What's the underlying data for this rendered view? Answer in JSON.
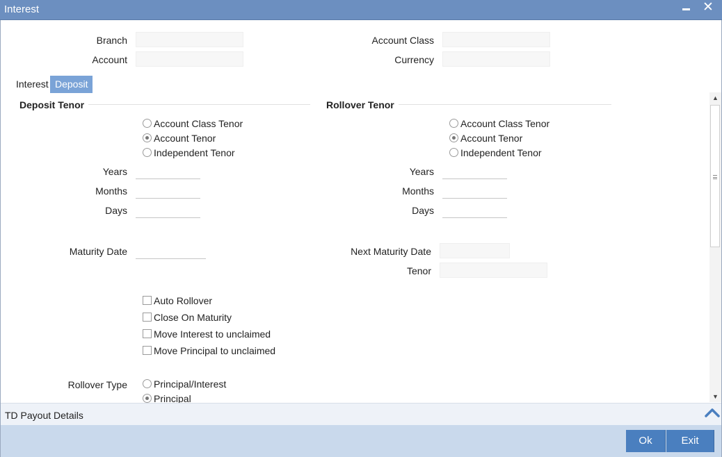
{
  "window": {
    "title": "Interest",
    "close_glyph": "✕"
  },
  "header": {
    "branch_label": "Branch",
    "account_label": "Account",
    "account_class_label": "Account Class",
    "currency_label": "Currency"
  },
  "tabs": [
    {
      "label": "Interest",
      "active": false
    },
    {
      "label": "Deposit",
      "active": true
    }
  ],
  "deposit_tenor": {
    "title": "Deposit Tenor",
    "options": [
      {
        "label": "Account Class Tenor",
        "checked": false
      },
      {
        "label": "Account Tenor",
        "checked": true
      },
      {
        "label": "Independent Tenor",
        "checked": false
      }
    ],
    "years_label": "Years",
    "months_label": "Months",
    "days_label": "Days",
    "maturity_date_label": "Maturity Date"
  },
  "rollover_tenor": {
    "title": "Rollover Tenor",
    "options": [
      {
        "label": "Account Class Tenor",
        "checked": false
      },
      {
        "label": "Account Tenor",
        "checked": true
      },
      {
        "label": "Independent Tenor",
        "checked": false
      }
    ],
    "years_label": "Years",
    "months_label": "Months",
    "days_label": "Days",
    "next_maturity_date_label": "Next Maturity Date",
    "tenor_label": "Tenor"
  },
  "checkboxes": [
    {
      "label": "Auto Rollover",
      "checked": false
    },
    {
      "label": "Close On Maturity",
      "checked": false
    },
    {
      "label": "Move Interest to unclaimed",
      "checked": false
    },
    {
      "label": "Move Principal to unclaimed",
      "checked": false
    }
  ],
  "rollover_type": {
    "label": "Rollover Type",
    "options": [
      {
        "label": "Principal/Interest",
        "checked": false
      },
      {
        "label": "Principal",
        "checked": true
      }
    ]
  },
  "payout": {
    "label": "TD Payout Details"
  },
  "footer": {
    "ok_label": "Ok",
    "exit_label": "Exit"
  },
  "colors": {
    "titlebar": "#6c8fc0",
    "active_tab": "#7aa3d7",
    "button": "#4a7fbf",
    "footer": "#c9d9ec"
  }
}
